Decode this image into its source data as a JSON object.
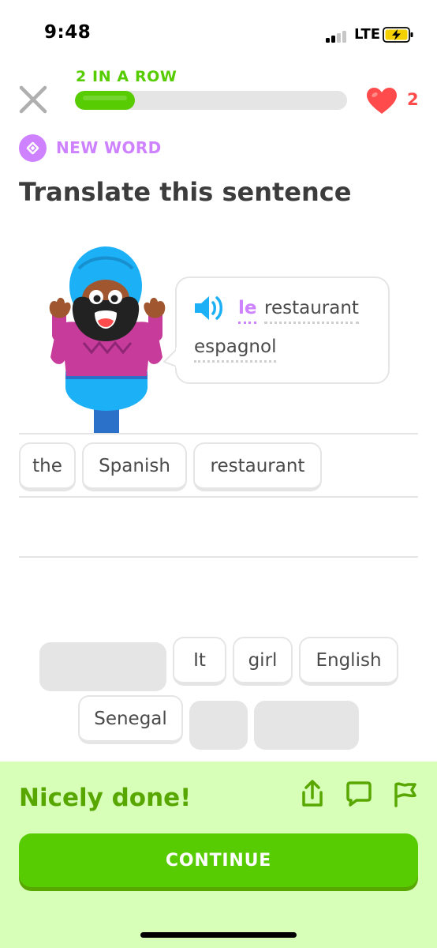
{
  "status_bar": {
    "time": "9:48",
    "network": "LTE"
  },
  "lesson": {
    "streak_label": "2 IN A ROW",
    "progress": 0.22,
    "hearts": "2"
  },
  "badge": {
    "label": "NEW WORD"
  },
  "prompt": {
    "title": "Translate this sentence"
  },
  "sentence": {
    "words": [
      "le",
      "restaurant",
      "espagnol"
    ]
  },
  "answer_tiles": [
    "the",
    "Spanish",
    "restaurant"
  ],
  "word_bank": {
    "visible_tiles": [
      "It",
      "girl",
      "English",
      "Senegal"
    ]
  },
  "feedback": {
    "message": "Nicely done!",
    "continue_label": "CONTINUE"
  },
  "colors": {
    "primary_green": "#58cc02",
    "feedback_bg": "#d7ffb8",
    "feedback_text": "#58a700",
    "new_word_purple": "#ce82ff",
    "heart_red": "#ff4b4b",
    "speaker_blue": "#1cb0f6"
  },
  "icons": [
    "close-icon",
    "heart-icon",
    "new-word-icon",
    "speaker-icon",
    "share-icon",
    "comment-icon",
    "flag-icon"
  ]
}
